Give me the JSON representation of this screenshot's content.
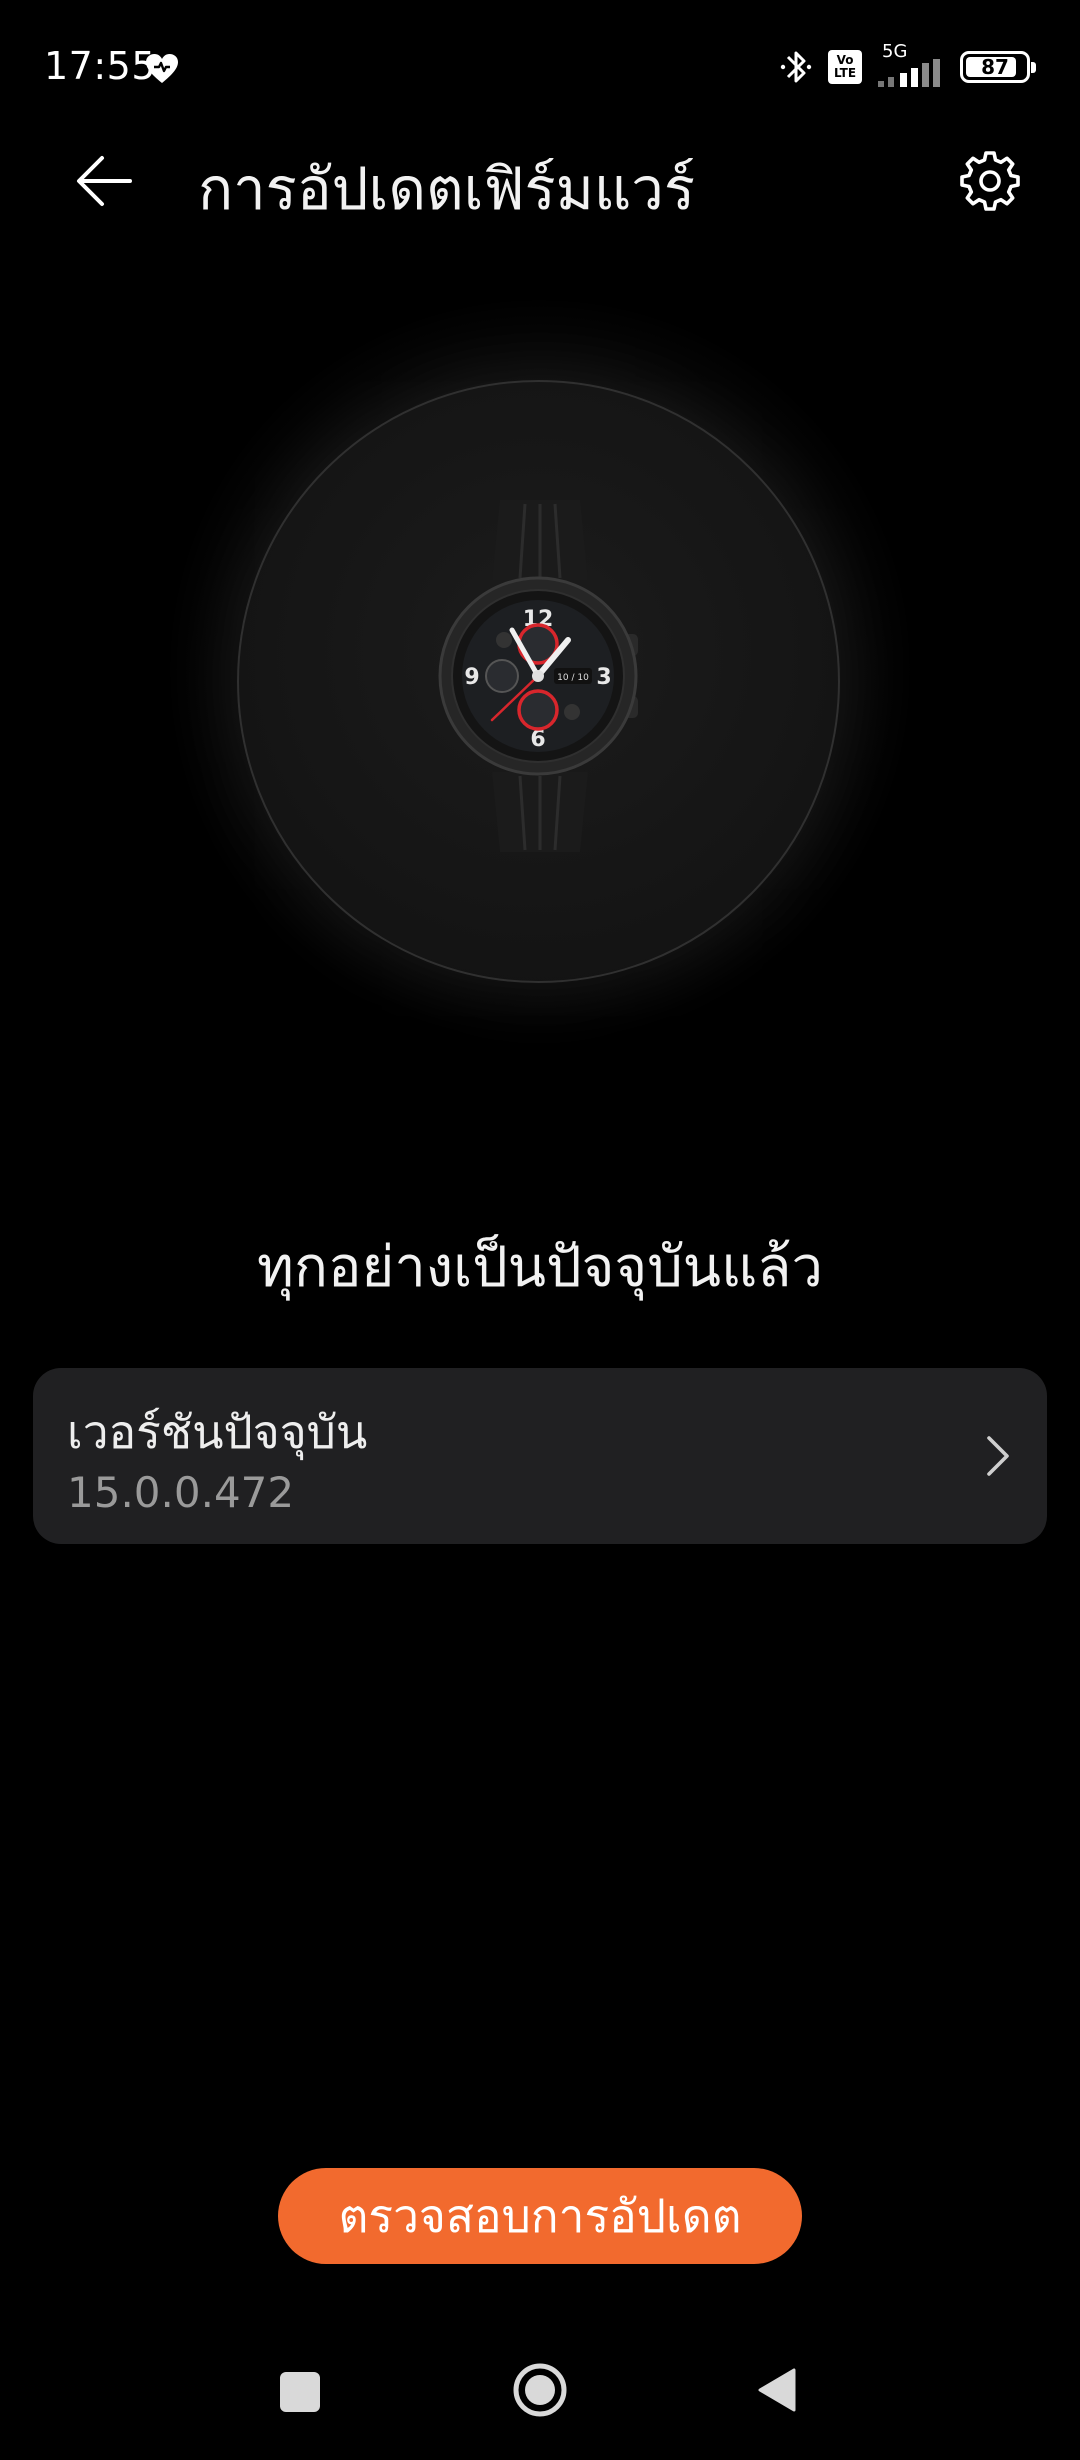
{
  "status_bar": {
    "time": "17:55",
    "network": "5G",
    "volte_top": "Vo",
    "volte_bottom": "LTE",
    "battery_level": "87",
    "battery_fraction": 0.87
  },
  "app_bar": {
    "title": "การอัปเดตเฟิร์มแวร์",
    "back_icon": "arrow-left-icon",
    "settings_icon": "gear-icon"
  },
  "hero": {
    "watch_face": {
      "hour_12": "12",
      "hour_3": "3",
      "hour_6": "6",
      "hour_9": "9",
      "date": "10 / 10"
    }
  },
  "main": {
    "status_message": "ทุกอย่างเป็นปัจจุบันแล้ว",
    "version_card": {
      "label": "เวอร์ชันปัจจุบัน",
      "value": "15.0.0.472"
    },
    "check_update_label": "ตรวจสอบการอัปเดต"
  },
  "colors": {
    "background": "#000000",
    "card": "#202022",
    "accent": "#f26a2e",
    "watch_accent_red": "#d8262c"
  }
}
